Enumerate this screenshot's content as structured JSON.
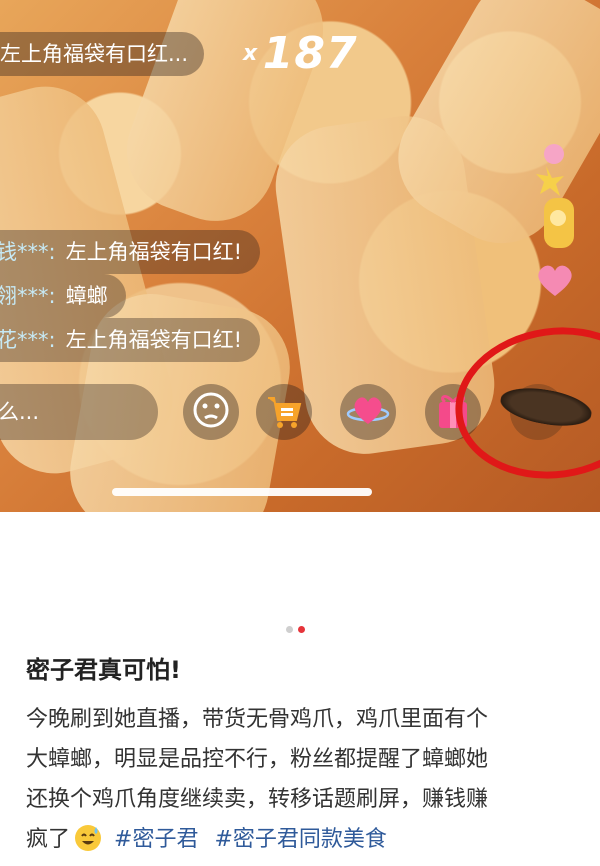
{
  "live": {
    "top_message": "左上角福袋有口红...",
    "combo_prefix": "x",
    "combo_count": "187",
    "comments": [
      {
        "user": "钱***:",
        "text": "左上角福袋有口红!"
      },
      {
        "user": "翎***:",
        "text": "蟑螂"
      },
      {
        "user": "花***:",
        "text": "左上角福袋有口红!"
      }
    ],
    "input_placeholder": "么...",
    "buttons": [
      "emoji-icon",
      "cart-icon",
      "heart-planet-icon",
      "gift-icon",
      "more-icon"
    ]
  },
  "carousel": {
    "total": 2,
    "active": 2
  },
  "post": {
    "title": "密子君真可怕!",
    "lines": [
      "今晚刷到她直播，带货无骨鸡爪，鸡爪里面有个",
      "大蟑螂，明显是品控不行，粉丝都提醒了蟑螂她",
      "还换个鸡爪角度继续卖，转移话题刷屏，赚钱赚"
    ],
    "last_line_prefix": "疯了",
    "tags": [
      "#密子君",
      "#密子君同款美食"
    ]
  },
  "colors": {
    "tag": "#2f5a9a",
    "accent": "#e6343a",
    "annotation_ring": "#e01818"
  }
}
